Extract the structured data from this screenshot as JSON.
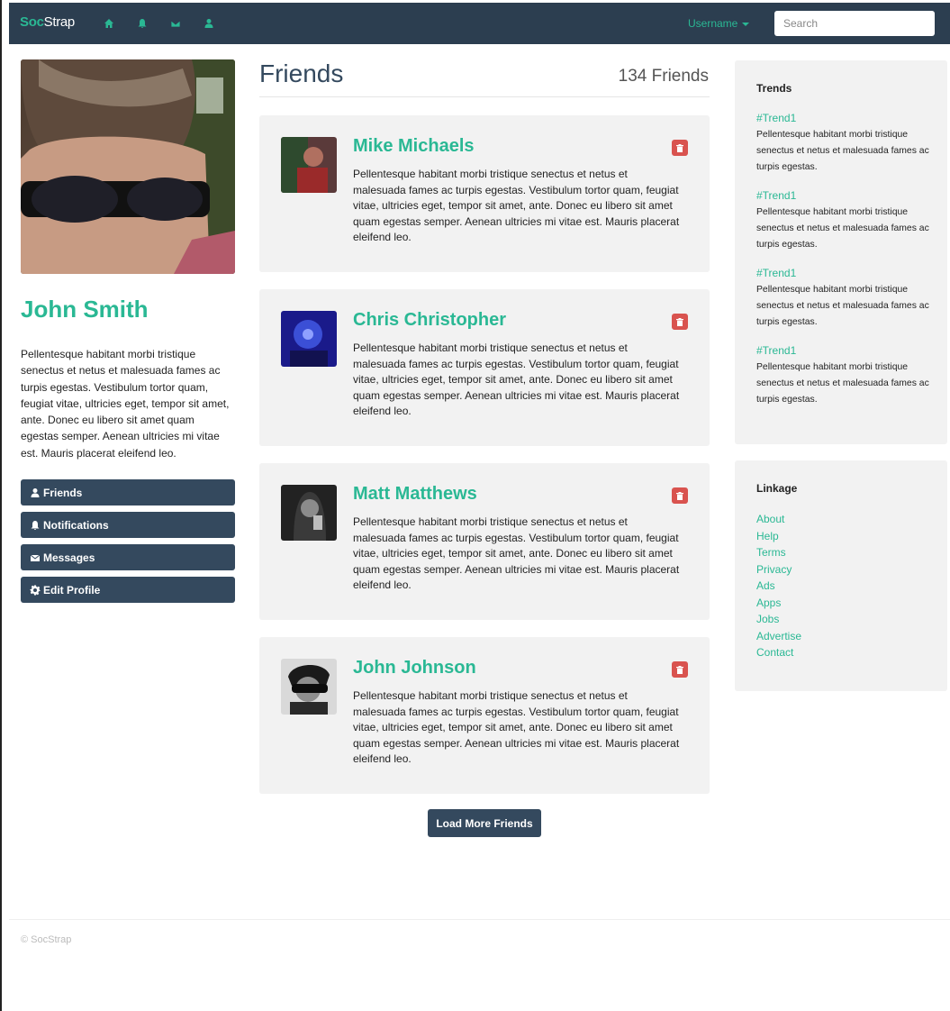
{
  "brand": {
    "prefix": "Soc",
    "suffix": "Strap"
  },
  "nav": {
    "icons": [
      "home-icon",
      "bell-icon",
      "envelope-icon",
      "user-icon"
    ],
    "username": "Username",
    "search_placeholder": "Search"
  },
  "profile": {
    "name": "John Smith",
    "bio": "Pellentesque habitant morbi tristique senectus et netus et malesuada fames ac turpis egestas. Vestibulum tortor quam, feugiat vitae, ultricies eget, tempor sit amet, ante. Donec eu libero sit amet quam egestas semper. Aenean ultricies mi vitae est. Mauris placerat eleifend leo.",
    "menu": [
      {
        "label": "Friends",
        "icon": "user-icon"
      },
      {
        "label": "Notifications",
        "icon": "bell-icon"
      },
      {
        "label": "Messages",
        "icon": "envelope-icon"
      },
      {
        "label": "Edit Profile",
        "icon": "gear-icon"
      }
    ]
  },
  "friends": {
    "title": "Friends",
    "count": "134 Friends",
    "items": [
      {
        "name": "Mike Michaels",
        "bio": "Pellentesque habitant morbi tristique senectus et netus et malesuada fames ac turpis egestas. Vestibulum tortor quam, feugiat vitae, ultricies eget, tempor sit amet, ante. Donec eu libero sit amet quam egestas semper. Aenean ultricies mi vitae est. Mauris placerat eleifend leo."
      },
      {
        "name": "Chris Christopher",
        "bio": "Pellentesque habitant morbi tristique senectus et netus et malesuada fames ac turpis egestas. Vestibulum tortor quam, feugiat vitae, ultricies eget, tempor sit amet, ante. Donec eu libero sit amet quam egestas semper. Aenean ultricies mi vitae est. Mauris placerat eleifend leo."
      },
      {
        "name": "Matt Matthews",
        "bio": "Pellentesque habitant morbi tristique senectus et netus et malesuada fames ac turpis egestas. Vestibulum tortor quam, feugiat vitae, ultricies eget, tempor sit amet, ante. Donec eu libero sit amet quam egestas semper. Aenean ultricies mi vitae est. Mauris placerat eleifend leo."
      },
      {
        "name": "John Johnson",
        "bio": "Pellentesque habitant morbi tristique senectus et netus et malesuada fames ac turpis egestas. Vestibulum tortor quam, feugiat vitae, ultricies eget, tempor sit amet, ante. Donec eu libero sit amet quam egestas semper. Aenean ultricies mi vitae est. Mauris placerat eleifend leo."
      }
    ],
    "load_more": "Load More Friends"
  },
  "trends": {
    "title": "Trends",
    "items": [
      {
        "tag": "#Trend1",
        "text": "Pellentesque habitant morbi tristique senectus et netus et malesuada fames ac turpis egestas."
      },
      {
        "tag": "#Trend1",
        "text": "Pellentesque habitant morbi tristique senectus et netus et malesuada fames ac turpis egestas."
      },
      {
        "tag": "#Trend1",
        "text": "Pellentesque habitant morbi tristique senectus et netus et malesuada fames ac turpis egestas."
      },
      {
        "tag": "#Trend1",
        "text": "Pellentesque habitant morbi tristique senectus et netus et malesuada fames ac turpis egestas."
      }
    ]
  },
  "linkage": {
    "title": "Linkage",
    "links": [
      "About",
      "Help",
      "Terms",
      "Privacy",
      "Ads",
      "Apps",
      "Jobs",
      "Advertise",
      "Contact"
    ]
  },
  "footer": {
    "text": "© SocStrap"
  },
  "colors": {
    "accent": "#2ab894",
    "navbar": "#2c3e50",
    "button": "#34495e",
    "danger": "#d9534f",
    "panel": "#f2f2f2"
  }
}
